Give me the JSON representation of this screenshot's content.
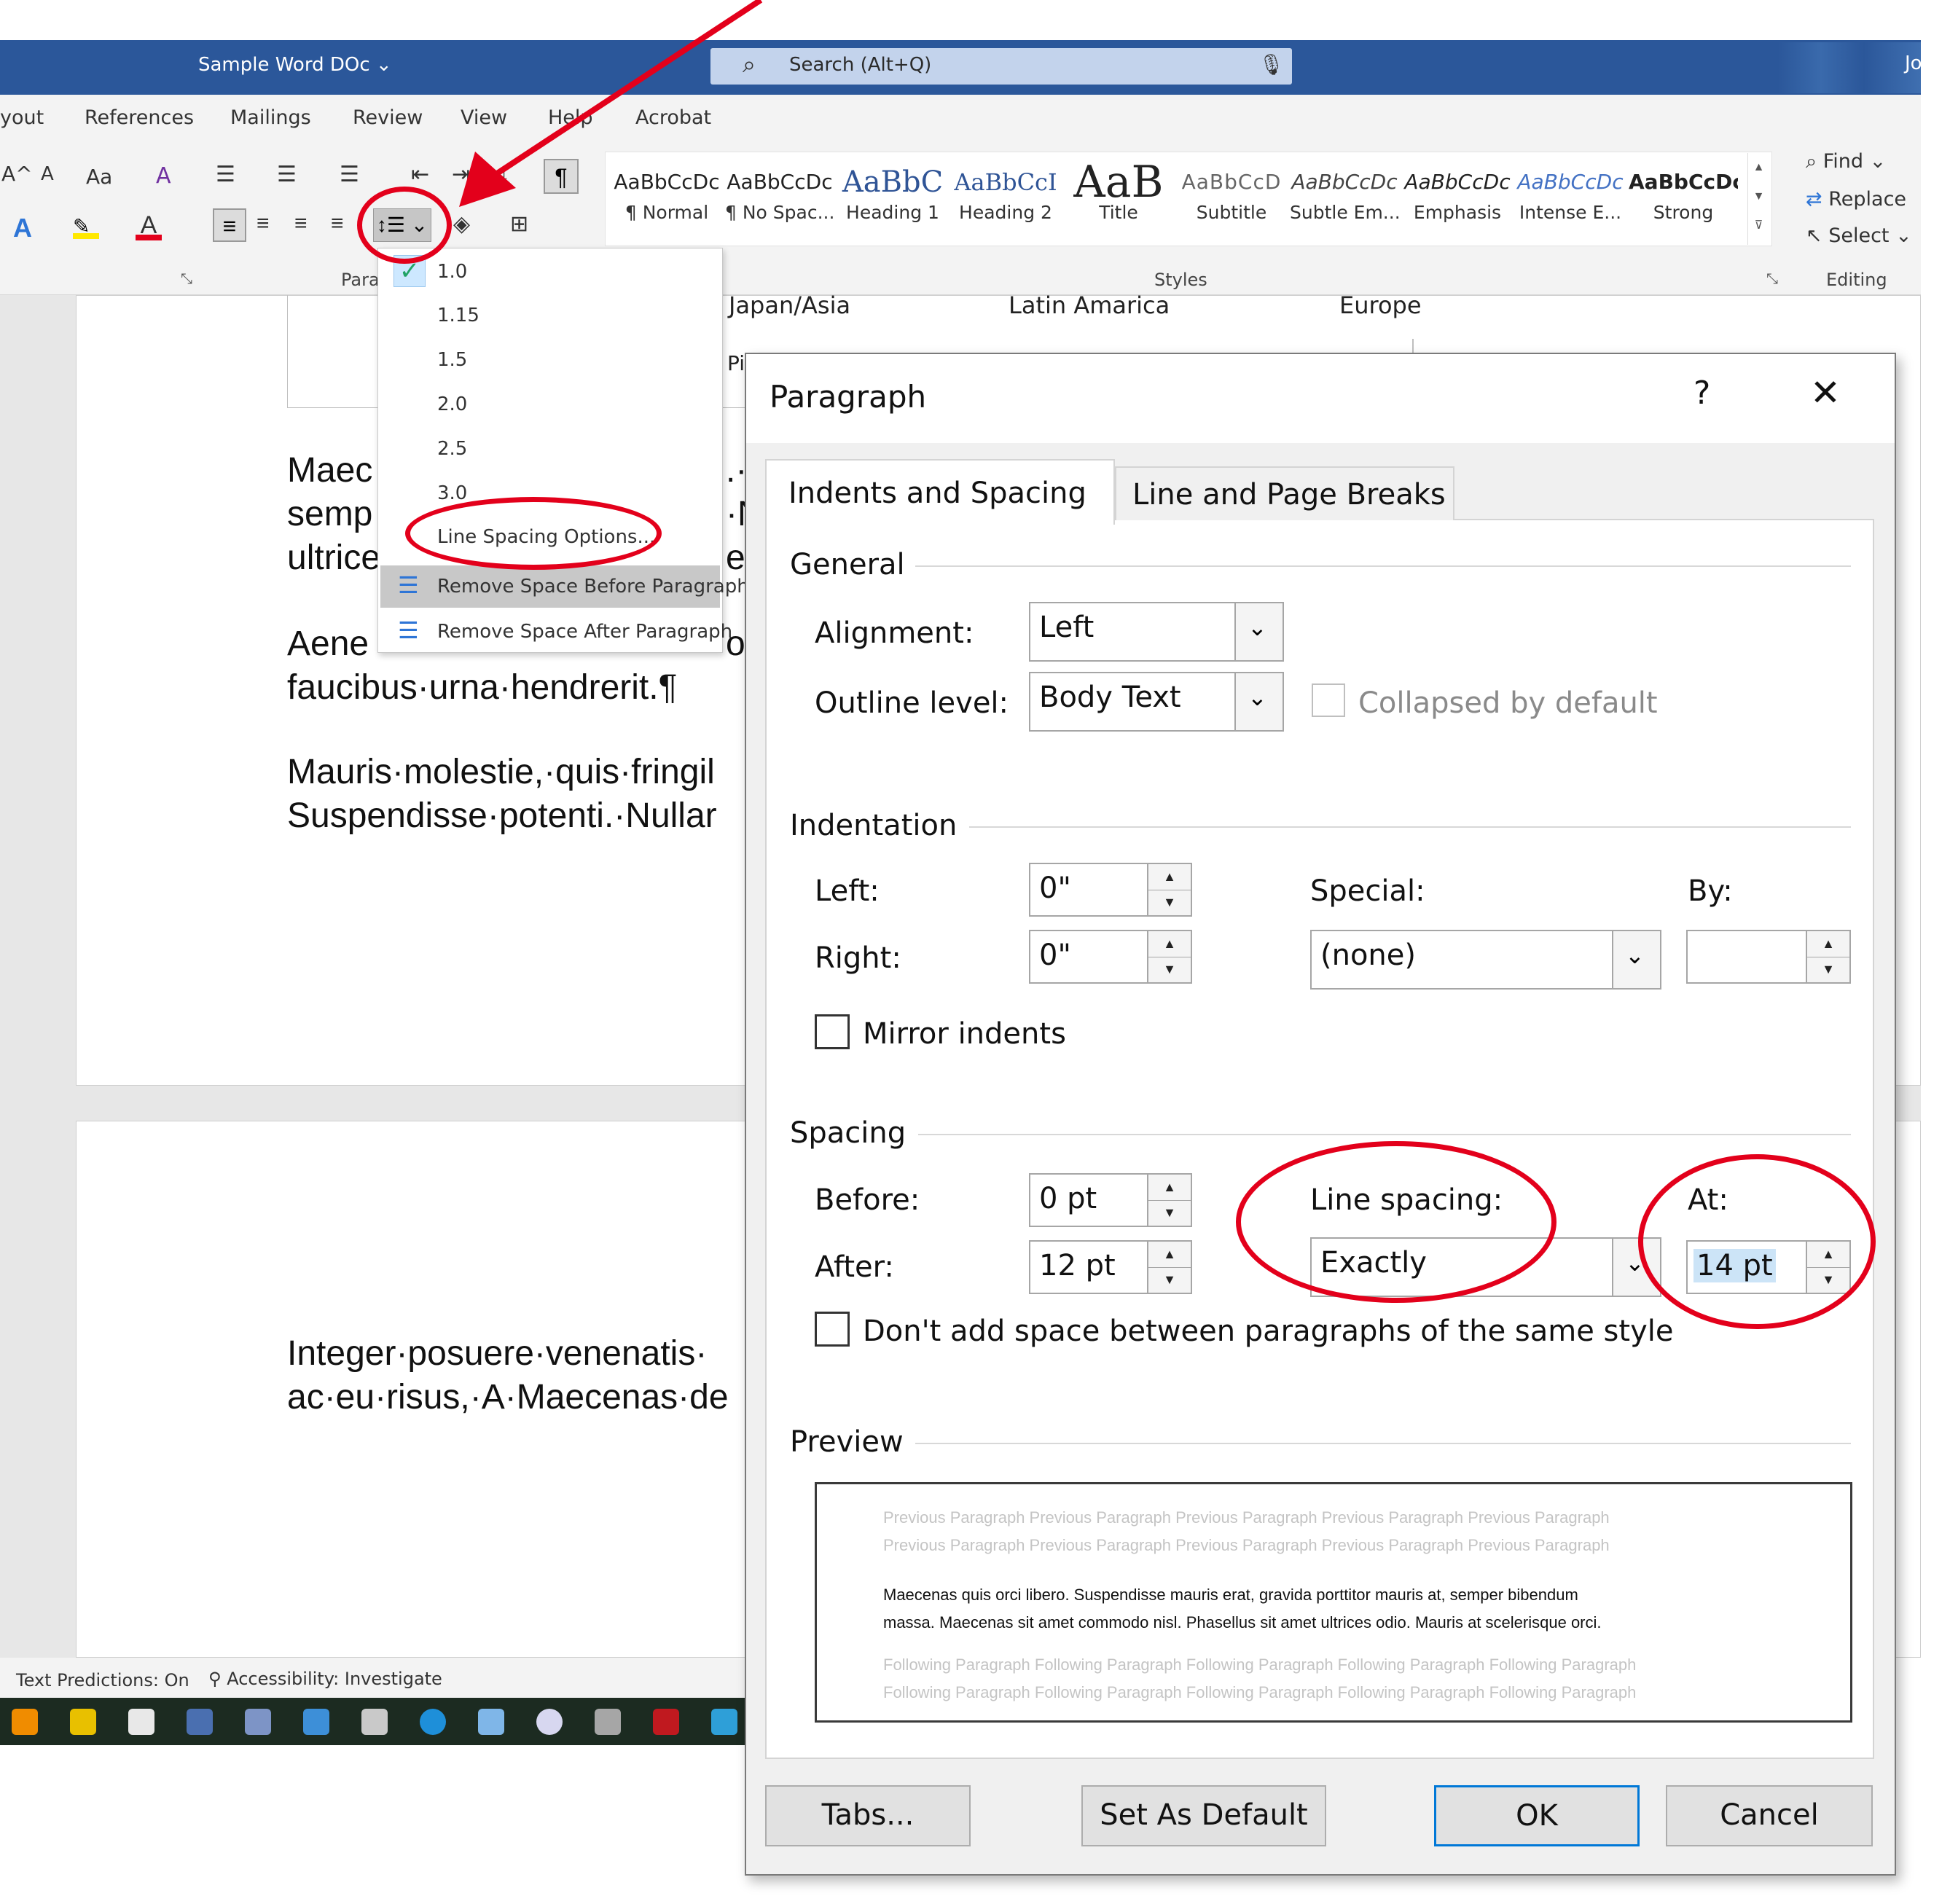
{
  "title_bar": {
    "doc_title": "Sample Word DOc",
    "search": "Search (Alt+Q)",
    "user_initial": "Jo"
  },
  "ribbon": {
    "tabs": [
      "yout",
      "References",
      "Mailings",
      "Review",
      "View",
      "Help",
      "Acrobat"
    ],
    "styles": [
      {
        "sample": "AaBbCcDc",
        "label": "¶ Normal"
      },
      {
        "sample": "AaBbCcDc",
        "label": "¶ No Spac..."
      },
      {
        "sample": "AaBbC",
        "label": "Heading 1"
      },
      {
        "sample": "AaBbCcI",
        "label": "Heading 2"
      },
      {
        "sample": "AaB",
        "label": "Title"
      },
      {
        "sample": "AaBbCcD",
        "label": "Subtitle"
      },
      {
        "sample": "AaBbCcDc",
        "label": "Subtle Em..."
      },
      {
        "sample": "AaBbCcDc",
        "label": "Emphasis"
      },
      {
        "sample": "AaBbCcDc",
        "label": "Intense E..."
      },
      {
        "sample": "AaBbCcDc",
        "label": "Strong"
      }
    ],
    "groups": {
      "paragraph": "Para",
      "styles": "Styles",
      "editing": "Editing"
    },
    "editing": {
      "find": "Find",
      "replace": "Replace",
      "select": "Select"
    },
    "font_labels": {
      "grow": "A^",
      "shrink": "A",
      "case": "Aa",
      "clear": "A"
    }
  },
  "line_spacing_menu": {
    "options": [
      "1.0",
      "1.15",
      "1.5",
      "2.0",
      "2.5",
      "3.0"
    ],
    "checked": "1.0",
    "options_link": "Line Spacing Options...",
    "remove_before": "Remove Space Before Paragraph",
    "remove_after": "Remove Space After Paragraph"
  },
  "document": {
    "table_headers": [
      "Japan/Asia",
      "Latin Amarica",
      "Europe"
    ],
    "table_fragment": "Pi",
    "para1": [
      "Maec",
      "semp",
      "ultrice"
    ],
    "para1_frag": [
      ".·",
      "·N",
      "el"
    ],
    "para2": [
      "Aene",
      "faucibus·urna·hendrerit.¶"
    ],
    "para2_frag": "o",
    "para3": [
      "Mauris·molestie,·quis·fringil",
      "Suspendisse·potenti.·Nullar"
    ],
    "para4": [
      "Integer·posuere·venenatis·",
      "ac·eu·risus,·A·Maecenas·de"
    ]
  },
  "status_bar": {
    "predictions": "Text Predictions: On",
    "accessibility": "Accessibility: Investigate"
  },
  "dialog": {
    "title": "Paragraph",
    "help": "?",
    "close": "✕",
    "tabs": [
      "Indents and Spacing",
      "Line and Page Breaks"
    ],
    "general": {
      "heading": "General",
      "alignment_label": "Alignment:",
      "alignment_value": "Left",
      "outline_label": "Outline level:",
      "outline_value": "Body Text",
      "collapsed_label": "Collapsed by default"
    },
    "indentation": {
      "heading": "Indentation",
      "left_label": "Left:",
      "left_value": "0\"",
      "right_label": "Right:",
      "right_value": "0\"",
      "special_label": "Special:",
      "special_value": "(none)",
      "by_label": "By:",
      "by_value": "",
      "mirror_label": "Mirror indents"
    },
    "spacing": {
      "heading": "Spacing",
      "before_label": "Before:",
      "before_value": "0 pt",
      "after_label": "After:",
      "after_value": "12 pt",
      "line_spacing_label": "Line spacing:",
      "line_spacing_value": "Exactly",
      "at_label": "At:",
      "at_value": "14 pt",
      "dont_add_label": "Don't add space between paragraphs of the same style"
    },
    "preview": {
      "heading": "Preview",
      "previous": [
        "Previous Paragraph Previous Paragraph Previous Paragraph Previous Paragraph Previous Paragraph",
        "Previous Paragraph Previous Paragraph Previous Paragraph Previous Paragraph Previous Paragraph"
      ],
      "sample": [
        "Maecenas quis orci libero. Suspendisse mauris erat, gravida porttitor mauris at, semper bibendum",
        "massa. Maecenas sit amet commodo nisl. Phasellus sit amet ultrices odio. Mauris at scelerisque orci."
      ],
      "following": [
        "Following Paragraph Following Paragraph Following Paragraph Following Paragraph Following Paragraph",
        "Following Paragraph Following Paragraph Following Paragraph Following Paragraph Following Paragraph"
      ]
    },
    "buttons": {
      "tabs": "Tabs...",
      "set_default": "Set As Default",
      "ok": "OK",
      "cancel": "Cancel"
    }
  },
  "colors": {
    "accent": "#2b579a",
    "annotation": "#e3001b",
    "selection": "#cce4f7"
  }
}
